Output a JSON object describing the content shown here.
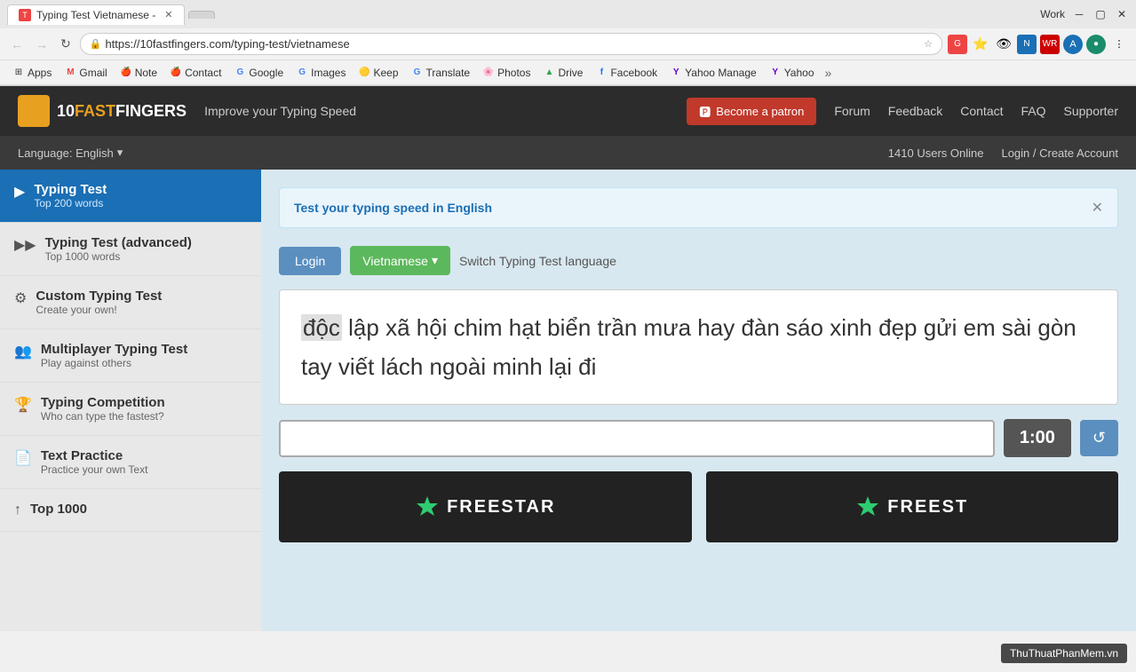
{
  "browser": {
    "tab_title": "Typing Test Vietnamese -",
    "tab_favicon": "T",
    "url": "https://10fastfingers.com/typing-test/vietnamese",
    "url_prefix": "https://",
    "bookmarks": [
      {
        "label": "Apps",
        "icon": "⊞"
      },
      {
        "label": "Gmail",
        "icon": "M"
      },
      {
        "label": "Note",
        "icon": "🍎"
      },
      {
        "label": "Contact",
        "icon": "🍎"
      },
      {
        "label": "Google",
        "icon": "G"
      },
      {
        "label": "Images",
        "icon": "G"
      },
      {
        "label": "Keep",
        "icon": "🟡"
      },
      {
        "label": "Translate",
        "icon": "G"
      },
      {
        "label": "Photos",
        "icon": "🌸"
      },
      {
        "label": "Drive",
        "icon": "▲"
      },
      {
        "label": "Facebook",
        "icon": "f"
      },
      {
        "label": "Yahoo Manage",
        "icon": "Y"
      },
      {
        "label": "Yahoo",
        "icon": "Y"
      }
    ],
    "title_bar": {
      "title": "Work"
    }
  },
  "site": {
    "logo_text_fast": "FAST",
    "logo_text_fingers": "FINGERS",
    "tagline": "Improve your Typing Speed",
    "become_patron_btn": "Become a patron",
    "nav_items": [
      "Forum",
      "Feedback",
      "Contact",
      "FAQ",
      "Supporter"
    ],
    "language_label": "Language: English",
    "users_online": "1410 Users Online",
    "login_link": "Login / Create Account"
  },
  "sidebar": {
    "items": [
      {
        "id": "typing-test",
        "icon": "▶",
        "title": "Typing Test",
        "sub": "Top 200 words",
        "active": true
      },
      {
        "id": "typing-test-advanced",
        "icon": "▶▶",
        "title": "Typing Test (advanced)",
        "sub": "Top 1000 words",
        "active": false
      },
      {
        "id": "custom-typing-test",
        "icon": "⚙",
        "title": "Custom Typing Test",
        "sub": "Create your own!",
        "active": false
      },
      {
        "id": "multiplayer-typing-test",
        "icon": "👥",
        "title": "Multiplayer Typing Test",
        "sub": "Play against others",
        "active": false
      },
      {
        "id": "typing-competition",
        "icon": "🏆",
        "title": "Typing Competition",
        "sub": "Who can type the fastest?",
        "active": false
      },
      {
        "id": "text-practice",
        "icon": "📄",
        "title": "Text Practice",
        "sub": "Practice your own Text",
        "active": false
      },
      {
        "id": "top-1000",
        "icon": "↑",
        "title": "Top 1000",
        "sub": "",
        "active": false
      }
    ]
  },
  "content": {
    "banner_text": "Test your typing speed in ",
    "banner_lang": "English",
    "login_btn": "Login",
    "language_btn": "Vietnamese",
    "switch_text": "Switch Typing Test language",
    "typing_text": "độc lập xã hội chim hạt biển trần mưa hay đàn sáo xinh đẹp gửi em sài gòn tay viết lách ngoài minh lại đi",
    "typing_first_word": "độc",
    "timer": "1:00",
    "reset_btn": "↺",
    "freestar1": "FREESTAR",
    "freestar2": "FREEST"
  },
  "watermark": "ThuThuatPhanMem.vn"
}
